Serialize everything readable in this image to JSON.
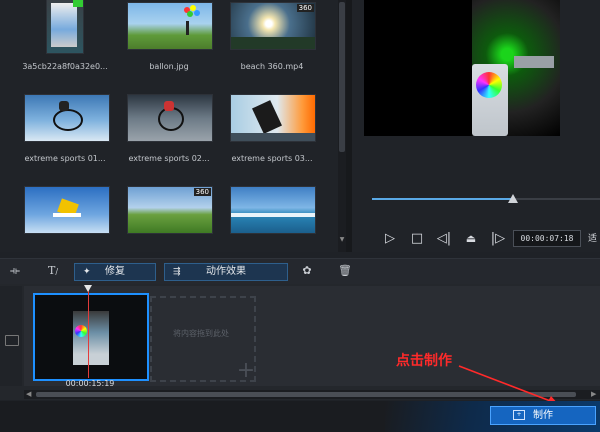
{
  "library": {
    "items": [
      {
        "label": "3a5cb22a8f0a32e0..."
      },
      {
        "label": "ballon.jpg"
      },
      {
        "label": "beach 360.mp4",
        "badge": "360"
      },
      {
        "label": "extreme sports 01..."
      },
      {
        "label": "extreme sports 02..."
      },
      {
        "label": "extreme sports 03..."
      },
      {
        "label": ""
      },
      {
        "label": "",
        "badge": "360"
      },
      {
        "label": ""
      }
    ]
  },
  "preview": {
    "timecode": "00:00:07:18",
    "next_control_partial": "适",
    "progress_fraction": 0.62
  },
  "toolbar": {
    "fix_label": "修复",
    "motion_label": "动作效果"
  },
  "timeline": {
    "clip_time": "00:00:15:19",
    "drop_hint": "将内容拖到此处"
  },
  "annotation": {
    "text": "点击制作"
  },
  "footer": {
    "make_label": "制作"
  },
  "colors": {
    "accent": "#1e90ff",
    "annotation": "#ff2a2a",
    "make_button": "#1565c0"
  }
}
